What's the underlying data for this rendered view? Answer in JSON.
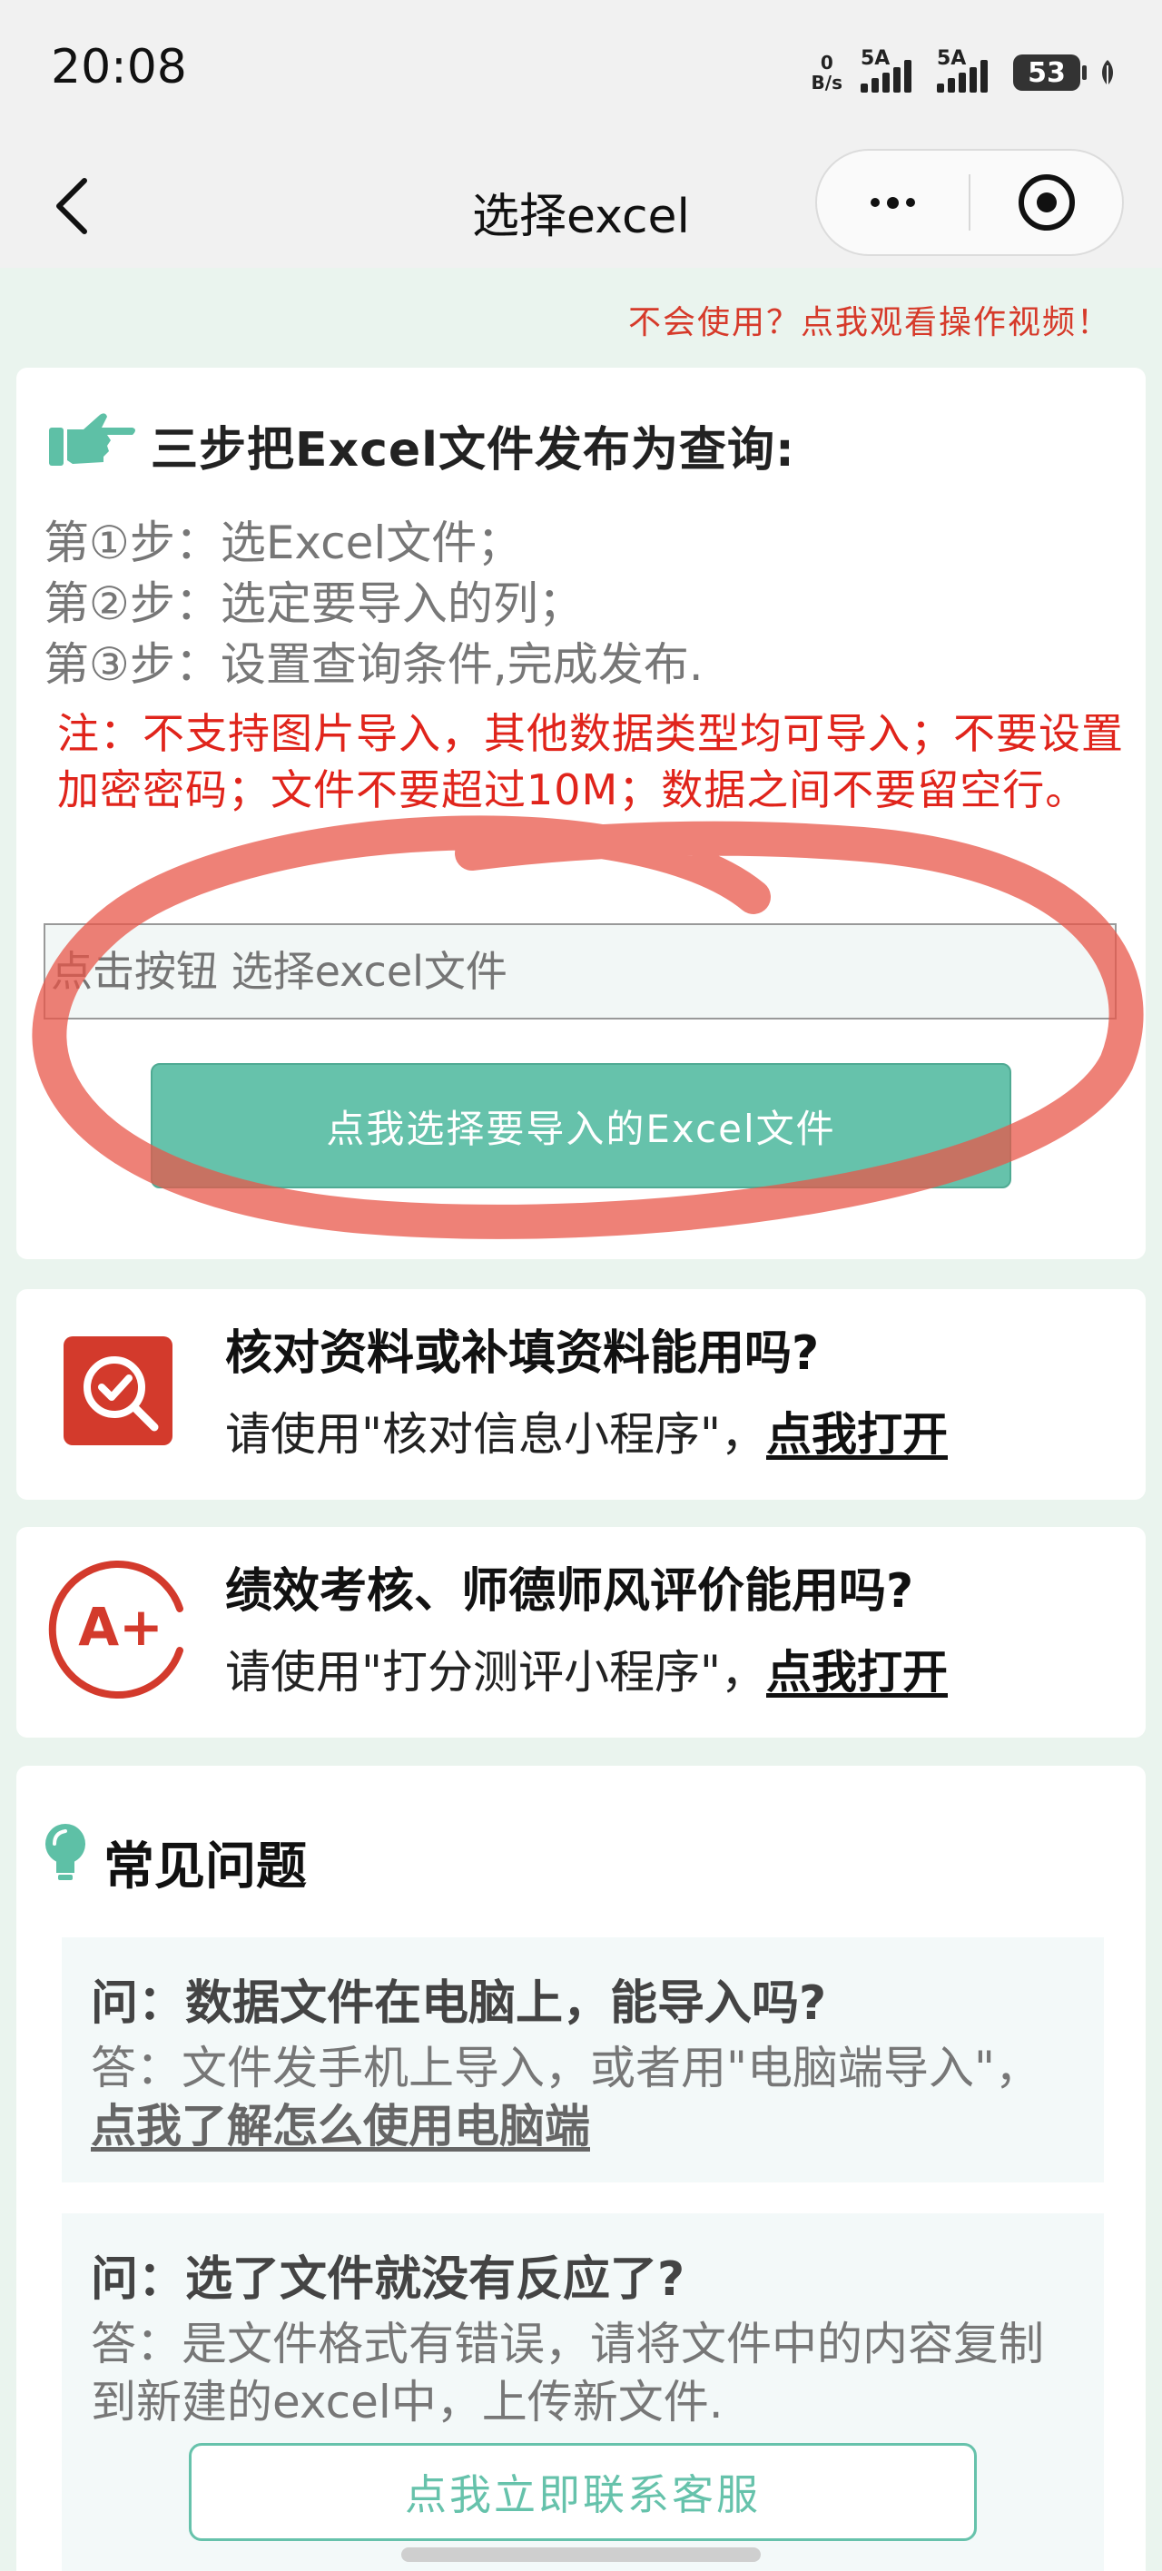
{
  "status_bar": {
    "time": "20:08",
    "net_speed_value": "0",
    "net_speed_unit": "B/s",
    "signal1_label": "5A",
    "signal2_label": "5A",
    "battery": "53"
  },
  "nav": {
    "title": "选择excel"
  },
  "video_link": "不会使用？点我观看操作视频！",
  "main_card": {
    "heading": "三步把Excel文件发布为查询:",
    "steps": [
      "第①步：选Excel文件；",
      "第②步：选定要导入的列；",
      "第③步：设置查询条件,完成发布."
    ],
    "warning": "注：不支持图片导入，其他数据类型均可导入；不要设置加密密码；文件不要超过10M；数据之间不要留空行。",
    "file_input_placeholder": "点击按钮 选择excel文件",
    "select_button": "点我选择要导入的Excel文件"
  },
  "verify_card": {
    "title": "核对资料或补填资料能用吗?",
    "desc_prefix": "请使用\"核对信息小程序\"，",
    "link": "点我打开"
  },
  "score_card": {
    "title": "绩效考核、师德师风评价能用吗?",
    "desc_prefix": "请使用\"打分测评小程序\"，",
    "link": "点我打开",
    "icon_text": "A+"
  },
  "faq": {
    "heading": "常见问题",
    "items": [
      {
        "q": "问：数据文件在电脑上，能导入吗?",
        "a_prefix": "答：文件发手机上导入，或者用\"电脑端导入\"，",
        "a_link": "点我了解怎么使用电脑端"
      },
      {
        "q": "问：选了文件就没有反应了?",
        "a_prefix": "答：是文件格式有错误，请将文件中的内容复制到新建的excel中，上传新文件.",
        "button": "点我立即联系客服"
      }
    ]
  },
  "colors": {
    "accent": "#66c2ab",
    "warning": "#e0241b",
    "background": "#eaf4ee",
    "annotation_circle": "#e8574a"
  }
}
